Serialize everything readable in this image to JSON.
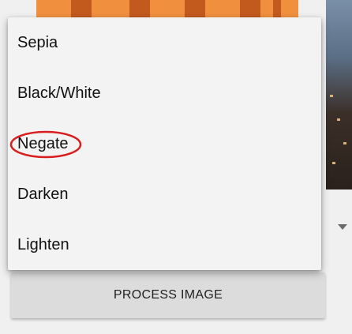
{
  "menu": {
    "items": [
      {
        "label": "Sepia"
      },
      {
        "label": "Black/White"
      },
      {
        "label": "Negate",
        "annotated": true
      },
      {
        "label": "Darken"
      },
      {
        "label": "Lighten"
      }
    ]
  },
  "button": {
    "process_label": "PROCESS IMAGE"
  },
  "colors": {
    "annotation": "#d81e1e",
    "menu_background": "#f3f3f3",
    "button_background": "#dcdcdc",
    "image_orange": "#f0903f"
  }
}
